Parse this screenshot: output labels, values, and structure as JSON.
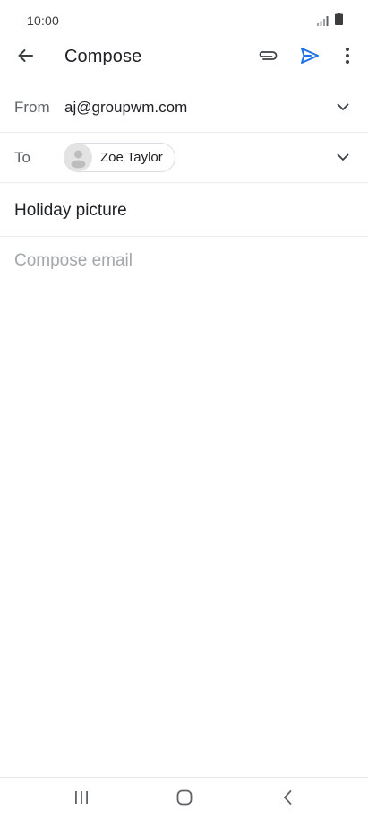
{
  "status_bar": {
    "time": "10:00",
    "signal_icon": "signal-icon",
    "battery_icon": "battery-icon"
  },
  "app_bar": {
    "title": "Compose",
    "back_icon": "arrow-back-icon",
    "attach_icon": "paperclip-icon",
    "send_icon": "send-icon",
    "more_icon": "more-vert-icon",
    "accent_color": "#1a73e8"
  },
  "from": {
    "label": "From",
    "value": "aj@groupwm.com"
  },
  "to": {
    "label": "To",
    "recipients": [
      {
        "name": "Zoe Taylor",
        "avatar_icon": "person-icon"
      }
    ]
  },
  "subject": {
    "value": "Holiday picture"
  },
  "body": {
    "placeholder": "Compose email",
    "value": ""
  },
  "nav_bar": {
    "recents_icon": "recents-icon",
    "home_icon": "home-icon",
    "back_icon": "nav-back-icon"
  }
}
